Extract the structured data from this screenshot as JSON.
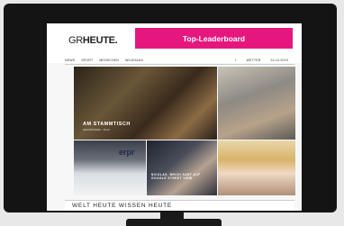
{
  "site": {
    "logo_gr": "GR",
    "logo_heute": "HEUTE."
  },
  "leaderboard": {
    "label": "Top-Leaderboard"
  },
  "nav": {
    "items": [
      "NEWS",
      "SPORT",
      "MENSCHEN",
      "WILDHAUS"
    ],
    "right": [
      "f",
      "WETTER",
      "24.10.2019"
    ]
  },
  "tiles": {
    "main_caption": "AM STAMMTISCH",
    "main_sub": "GRAUBÜNDEN · 16:40",
    "tile4_caption": "NICOLAS, BRICH SANT AUF GOOGLE STREET VIEW",
    "tile3_text": "erpr"
  },
  "bottom": {
    "tabs": "WELT HEUTE   WISSEN HEUTE"
  },
  "colors": {
    "accent": "#e5177e",
    "monitor": "#141414"
  }
}
